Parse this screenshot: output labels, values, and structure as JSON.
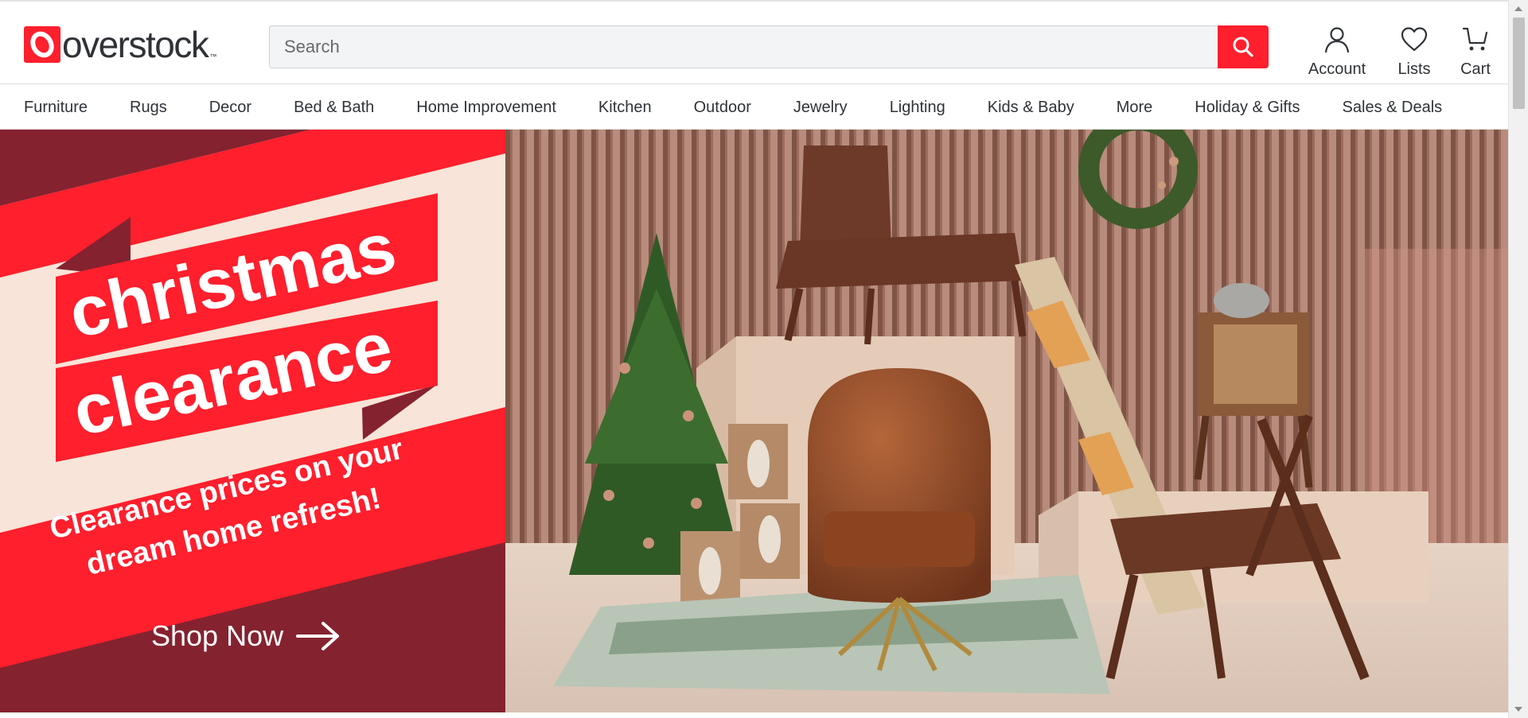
{
  "brand": {
    "logo_text": "overstock",
    "logo_tm": "™",
    "brand_red": "#ff1f2d"
  },
  "search": {
    "placeholder": "Search",
    "value": ""
  },
  "header_actions": {
    "account_label": "Account",
    "lists_label": "Lists",
    "cart_label": "Cart"
  },
  "nav": {
    "items": [
      {
        "label": "Furniture"
      },
      {
        "label": "Rugs"
      },
      {
        "label": "Decor"
      },
      {
        "label": "Bed & Bath"
      },
      {
        "label": "Home Improvement"
      },
      {
        "label": "Kitchen"
      },
      {
        "label": "Outdoor"
      },
      {
        "label": "Jewelry"
      },
      {
        "label": "Lighting"
      },
      {
        "label": "Kids & Baby"
      },
      {
        "label": "More"
      },
      {
        "label": "Holiday & Gifts"
      },
      {
        "label": "Sales & Deals"
      }
    ]
  },
  "hero": {
    "headline_line1": "christmas",
    "headline_line2": "clearance",
    "subline_line1": "Clearance prices on your",
    "subline_line2": "dream home refresh!",
    "cta_label": "Shop Now",
    "colors": {
      "maroon": "#85222f",
      "red": "#ff1f2d",
      "cream": "#f8e4d8"
    }
  },
  "icons": {
    "search": "search-icon",
    "account": "user-icon",
    "lists": "heart-icon",
    "cart": "cart-icon",
    "cta_arrow": "arrow-right-icon"
  }
}
